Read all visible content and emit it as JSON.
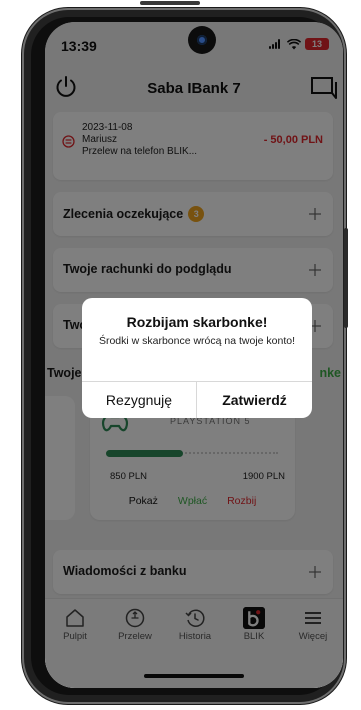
{
  "status_bar": {
    "time": "13:39",
    "battery": "13"
  },
  "header": {
    "title": "Saba IBank 7"
  },
  "transaction": {
    "date": "2023-11-08",
    "name": "Mariusz",
    "description": "Przelew na telefon BLIK...",
    "amount": "- 50,00 PLN"
  },
  "sections": {
    "pending_orders": {
      "label": "Zlecenia oczekujące",
      "count": "3"
    },
    "view_accounts": {
      "label": "Twoje rachunki do podglądu"
    },
    "partial_row": {
      "label": "Two"
    },
    "piggy_header": {
      "label": "Twoje",
      "action": "nke"
    },
    "messages": {
      "label": "Wiadomości z banku"
    }
  },
  "piggy_bank": {
    "name": "PLAYSTATION 5",
    "current": "850 PLN",
    "goal": "1900 PLN",
    "progress": 0.447,
    "actions": {
      "show": "Pokaż",
      "deposit": "Wpłać",
      "break": "Rozbij"
    }
  },
  "dialog": {
    "title": "Rozbijam skarbonke!",
    "message": "Środki w skarbonce wrócą na twoje konto!",
    "cancel_label": "Rezygnuję",
    "confirm_label": "Zatwierdź"
  },
  "bottom_nav": {
    "items": [
      {
        "label": "Pulpit",
        "icon": "home-icon"
      },
      {
        "label": "Przelew",
        "icon": "transfer-icon"
      },
      {
        "label": "Historia",
        "icon": "history-icon"
      },
      {
        "label": "BLIK",
        "icon": "blik-icon"
      },
      {
        "label": "Więcej",
        "icon": "menu-icon"
      }
    ]
  },
  "colors": {
    "negative": "#e0262c",
    "accent_green": "#3fae49",
    "progress_green": "#2e8b57",
    "badge_orange": "#f0a51e"
  }
}
